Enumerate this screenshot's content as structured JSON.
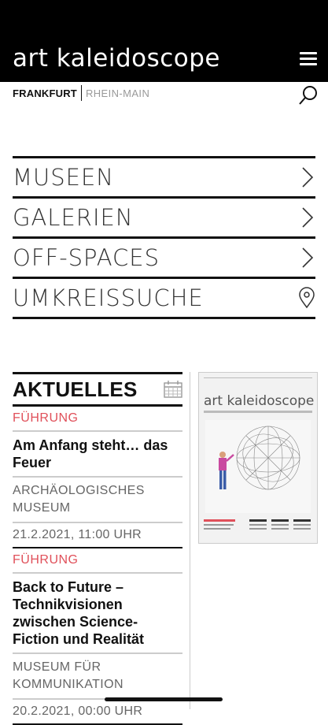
{
  "header": {
    "title": "art kaleidoscope"
  },
  "location": {
    "city": "FRANKFURT",
    "region": "RHEIN-MAIN"
  },
  "nav": [
    {
      "label": "MUSEEN",
      "icon": "chevron-right-icon"
    },
    {
      "label": "GALERIEN",
      "icon": "chevron-right-icon"
    },
    {
      "label": "OFF-SPACES",
      "icon": "chevron-right-icon"
    },
    {
      "label": "UMKREISSUCHE",
      "icon": "location-pin-icon"
    }
  ],
  "news": {
    "title": "AKTUELLES",
    "items": [
      {
        "type": "FÜHRUNG",
        "headline": "Am Anfang steht… das Feuer",
        "venue": "ARCHÄOLOGISCHES MUSEUM",
        "date": "21.2.2021, 11:00 UHR"
      },
      {
        "type": "FÜHRUNG",
        "headline": "Back to Future – Technikvisionen zwischen Science-Fiction und Realität",
        "venue": "MUSEUM FÜR KOMMUNIKATION",
        "date": "20.2.2021, 00:00 UHR"
      }
    ]
  },
  "magazine": {
    "title": "art kaleidoscope"
  },
  "colors": {
    "header_bg": "#000000",
    "accent_type": "#e0505a"
  }
}
